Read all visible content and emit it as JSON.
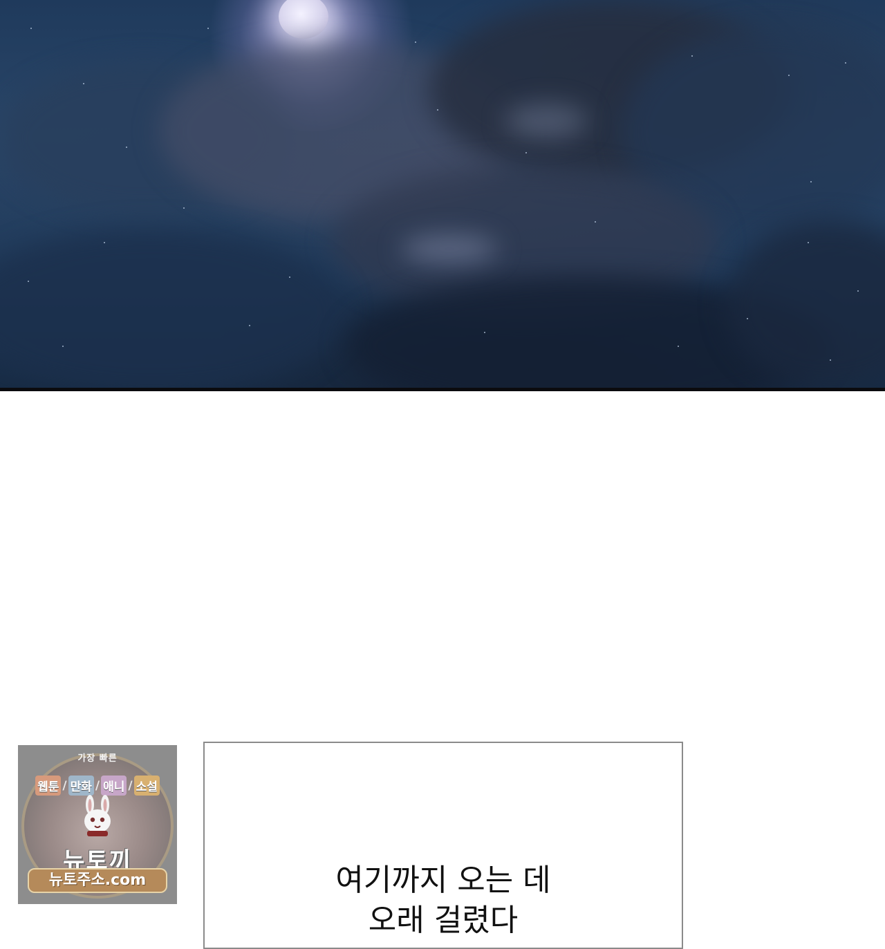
{
  "scene": {
    "description_icon": "night-sky-moon-icon"
  },
  "dialogue": {
    "line1": "여기까지 오는 데",
    "line2": "오래 걸렸다"
  },
  "promo": {
    "tagline": "가장 빠른",
    "categories": [
      "웹툰",
      "만화",
      "애니",
      "소설"
    ],
    "brand": "뉴토끼",
    "url": "뉴토주소.com"
  }
}
